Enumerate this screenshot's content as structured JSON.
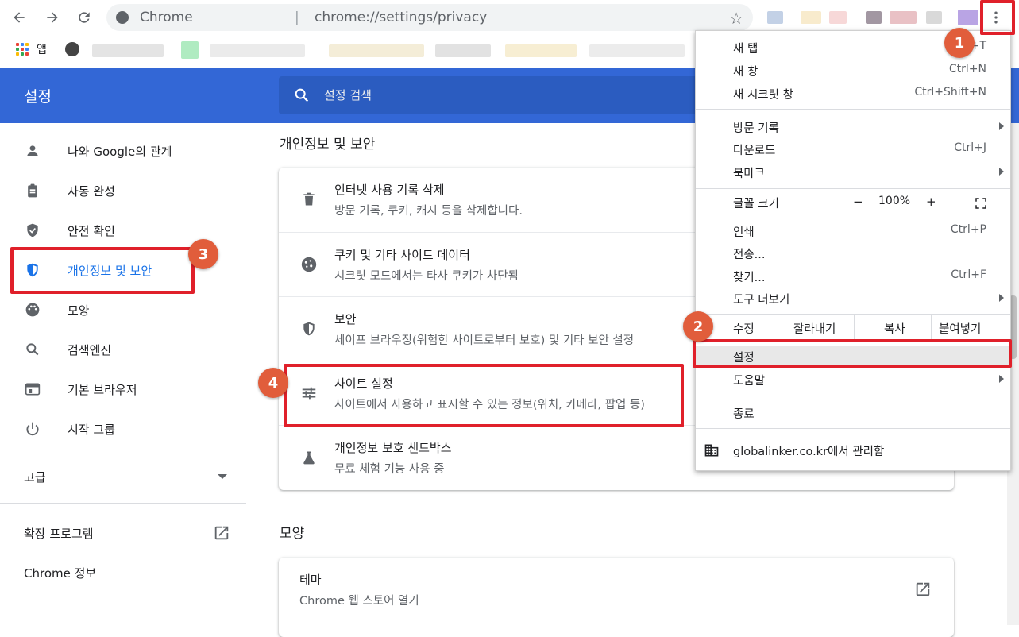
{
  "toolbar": {
    "omnibox_site": "Chrome",
    "omnibox_separator": "|",
    "url": "chrome://settings/privacy"
  },
  "bookmarks": {
    "apps_label": "앱"
  },
  "header": {
    "title": "설정",
    "search_placeholder": "설정 검색"
  },
  "sidebar": {
    "items": [
      {
        "label": "나와 Google의 관계",
        "icon": "person-icon"
      },
      {
        "label": "자동 완성",
        "icon": "clipboard-icon"
      },
      {
        "label": "안전 확인",
        "icon": "shield-check-icon"
      },
      {
        "label": "개인정보 및 보안",
        "icon": "shield-icon"
      },
      {
        "label": "모양",
        "icon": "palette-icon"
      },
      {
        "label": "검색엔진",
        "icon": "search-icon"
      },
      {
        "label": "기본 브라우저",
        "icon": "browser-icon"
      },
      {
        "label": "시작 그룹",
        "icon": "power-icon"
      }
    ],
    "advanced": "고급",
    "extensions": "확장 프로그램",
    "about": "Chrome 정보"
  },
  "main": {
    "privacy_title": "개인정보 및 보안",
    "rows": [
      {
        "title": "인터넷 사용 기록 삭제",
        "subtitle": "방문 기록, 쿠키, 캐시 등을 삭제합니다.",
        "icon": "trash-icon"
      },
      {
        "title": "쿠키 및 기타 사이트 데이터",
        "subtitle": "시크릿 모드에서는 타사 쿠키가 차단됨",
        "icon": "cookie-icon"
      },
      {
        "title": "보안",
        "subtitle": "세이프 브라우징(위험한 사이트로부터 보호) 및 기타 보안 설정",
        "icon": "shield-icon"
      },
      {
        "title": "사이트 설정",
        "subtitle": "사이트에서 사용하고 표시할 수 있는 정보(위치, 카메라, 팝업 등)",
        "icon": "tune-icon"
      },
      {
        "title": "개인정보 보호 샌드박스",
        "subtitle": "무료 체험 기능 사용 중",
        "icon": "flask-icon"
      }
    ],
    "appearance_title": "모양",
    "theme": {
      "title": "테마",
      "subtitle": "Chrome 웹 스토어 열기"
    }
  },
  "menu": {
    "new_tab": "새 탭",
    "new_tab_shortcut": "Ctrl+T",
    "new_window": "새 창",
    "new_window_shortcut": "Ctrl+N",
    "new_incognito": "새 시크릿 창",
    "new_incognito_shortcut": "Ctrl+Shift+N",
    "history": "방문 기록",
    "downloads": "다운로드",
    "downloads_shortcut": "Ctrl+J",
    "bookmarks": "북마크",
    "zoom_label": "글꼴 크기",
    "zoom_minus": "−",
    "zoom_value": "100%",
    "zoom_plus": "+",
    "print": "인쇄",
    "print_shortcut": "Ctrl+P",
    "cast": "전송...",
    "find": "찾기...",
    "find_shortcut": "Ctrl+F",
    "more_tools": "도구 더보기",
    "edit": "수정",
    "cut": "잘라내기",
    "copy": "복사",
    "paste": "붙여넣기",
    "settings": "설정",
    "help": "도움말",
    "exit": "종료",
    "managed": "globalinker.co.kr에서 관리함"
  },
  "annotations": {
    "badge1": "1",
    "badge2": "2",
    "badge3": "3",
    "badge4": "4"
  },
  "colors": {
    "header_blue": "#3367d6",
    "accent": "#1a73e8",
    "annotation_red": "#e0202a",
    "badge": "#e15d3b"
  }
}
